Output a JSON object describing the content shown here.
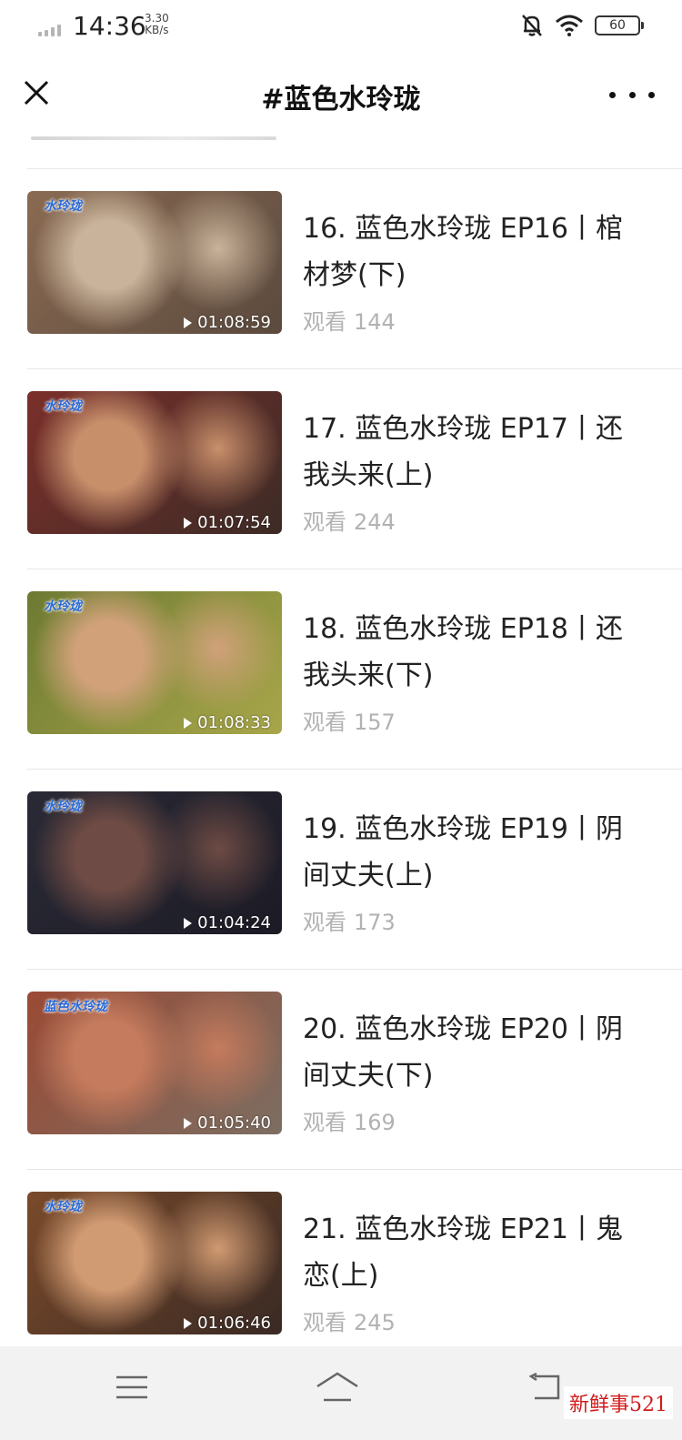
{
  "status_bar": {
    "time": "14:36",
    "net_speed_value": "3.30",
    "net_speed_unit": "KB/s",
    "battery": "60"
  },
  "nav": {
    "title": "#蓝色水玲珑"
  },
  "videos": [
    {
      "title": "16. 蓝色水玲珑 EP16丨棺材梦(下)",
      "views_label": "观看",
      "views": "144",
      "duration": "01:08:59",
      "logo": "水玲珑",
      "colors": [
        "#8a6a52",
        "#c9b39a",
        "#5b4a3e"
      ]
    },
    {
      "title": "17. 蓝色水玲珑 EP17丨还我头来(上)",
      "views_label": "观看",
      "views": "244",
      "duration": "01:07:54",
      "logo": "水玲珑",
      "colors": [
        "#7b2f2a",
        "#c88f6b",
        "#3d2b26"
      ]
    },
    {
      "title": "18. 蓝色水玲珑 EP18丨还我头来(下)",
      "views_label": "观看",
      "views": "157",
      "duration": "01:08:33",
      "logo": "水玲珑",
      "colors": [
        "#6d7a32",
        "#d1a17a",
        "#a8a64a"
      ]
    },
    {
      "title": "19. 蓝色水玲珑 EP19丨阴间丈夫(上)",
      "views_label": "观看",
      "views": "173",
      "duration": "01:04:24",
      "logo": "水玲珑",
      "colors": [
        "#2a2a36",
        "#6e4b44",
        "#1c1b25"
      ]
    },
    {
      "title": "20. 蓝色水玲珑 EP20丨阴间丈夫(下)",
      "views_label": "观看",
      "views": "169",
      "duration": "01:05:40",
      "logo": "蓝色水玲珑",
      "colors": [
        "#9a4a35",
        "#c57b5d",
        "#7c6e62"
      ]
    },
    {
      "title": "21. 蓝色水玲珑 EP21丨鬼恋(上)",
      "views_label": "观看",
      "views": "245",
      "duration": "01:06:46",
      "logo": "水玲珑",
      "colors": [
        "#7a4a2a",
        "#d09a72",
        "#3a2a24"
      ]
    }
  ],
  "watermark": "新鲜事521"
}
